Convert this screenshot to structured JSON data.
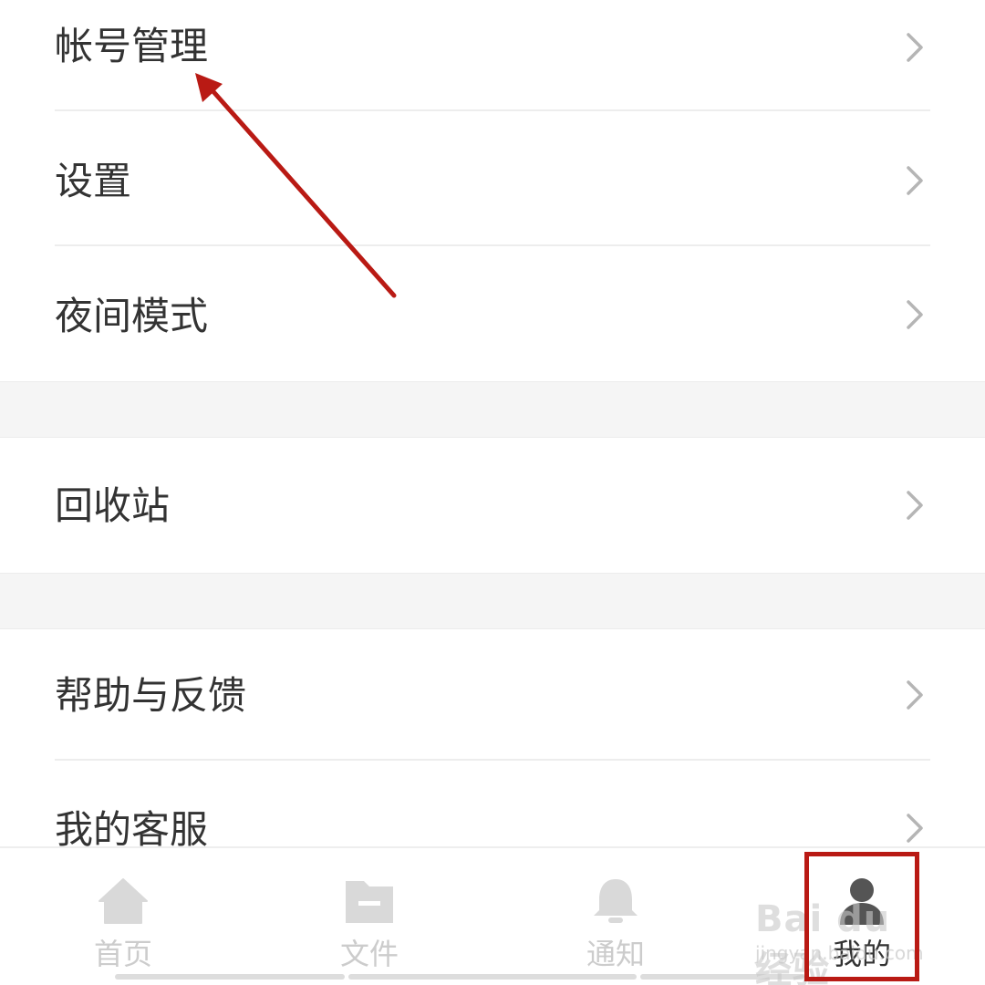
{
  "menu": {
    "group1": [
      {
        "label": "帐号管理"
      },
      {
        "label": "设置"
      },
      {
        "label": "夜间模式"
      }
    ],
    "group2": [
      {
        "label": "回收站"
      }
    ],
    "group3": [
      {
        "label": "帮助与反馈"
      },
      {
        "label": "我的客服"
      }
    ]
  },
  "tabbar": {
    "tabs": [
      {
        "label": "首页",
        "icon": "home-icon",
        "active": false
      },
      {
        "label": "文件",
        "icon": "folder-icon",
        "active": false
      },
      {
        "label": "通知",
        "icon": "bell-icon",
        "active": false
      },
      {
        "label": "我的",
        "icon": "user-icon",
        "active": true
      }
    ]
  },
  "watermark": {
    "brand": "Bai du 经验",
    "url": "jingyan.baidu.com"
  },
  "colors": {
    "text": "#333333",
    "inactive": "#cccccc",
    "icon_inactive": "#d9d9d9",
    "active_icon": "#555555",
    "annotation": "#b91a14",
    "divider": "#ededed",
    "section_gap": "#f5f5f5"
  }
}
